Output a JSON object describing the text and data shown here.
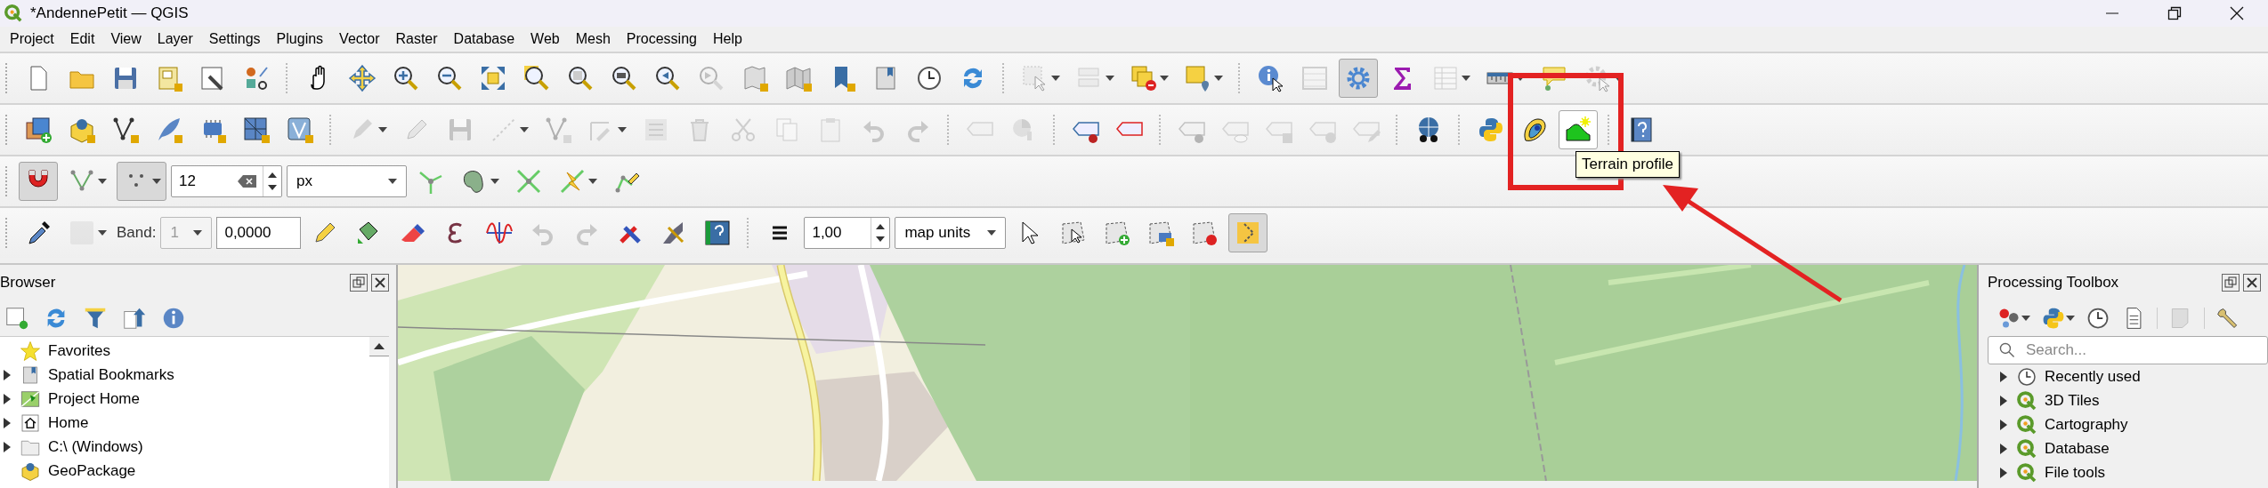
{
  "window": {
    "title": "*AndennePetit — QGIS"
  },
  "menu_bar": [
    "Project",
    "Edit",
    "View",
    "Layer",
    "Settings",
    "Plugins",
    "Vector",
    "Raster",
    "Database",
    "Web",
    "Mesh",
    "Processing",
    "Help"
  ],
  "toolbars": [
    {
      "items": [
        {
          "kind": "button",
          "disabled": false,
          "checked": false,
          "hovered": false,
          "dropdown": false
        },
        {
          "kind": "button",
          "disabled": false,
          "checked": false,
          "hovered": false,
          "dropdown": false
        },
        {
          "kind": "button",
          "disabled": false,
          "checked": false,
          "hovered": false,
          "dropdown": false
        },
        {
          "kind": "button",
          "disabled": false,
          "checked": false,
          "hovered": false,
          "dropdown": false
        },
        {
          "kind": "button",
          "disabled": false,
          "checked": false,
          "hovered": false,
          "dropdown": false
        },
        {
          "kind": "button",
          "disabled": false,
          "checked": false,
          "hovered": false,
          "dropdown": false
        },
        {
          "kind": "separator"
        },
        {
          "kind": "button",
          "disabled": false,
          "checked": false,
          "hovered": false,
          "dropdown": false
        },
        {
          "kind": "button",
          "disabled": false,
          "checked": false,
          "hovered": false,
          "dropdown": false
        },
        {
          "kind": "button",
          "disabled": false,
          "checked": false,
          "hovered": false,
          "dropdown": false
        },
        {
          "kind": "button",
          "disabled": false,
          "checked": false,
          "hovered": false,
          "dropdown": false
        },
        {
          "kind": "button",
          "disabled": false,
          "checked": false,
          "hovered": false,
          "dropdown": false
        },
        {
          "kind": "button",
          "disabled": false,
          "checked": false,
          "hovered": false,
          "dropdown": false
        },
        {
          "kind": "button",
          "disabled": false,
          "checked": false,
          "hovered": false,
          "dropdown": false
        },
        {
          "kind": "button",
          "disabled": false,
          "checked": false,
          "hovered": false,
          "dropdown": false
        },
        {
          "kind": "button",
          "disabled": false,
          "checked": false,
          "hovered": false,
          "dropdown": false
        },
        {
          "kind": "button",
          "disabled": true,
          "checked": false,
          "hovered": false,
          "dropdown": false
        },
        {
          "kind": "button",
          "disabled": false,
          "checked": false,
          "hovered": false,
          "dropdown": false
        },
        {
          "kind": "button",
          "disabled": false,
          "checked": false,
          "hovered": false,
          "dropdown": false
        },
        {
          "kind": "button",
          "disabled": false,
          "checked": false,
          "hovered": false,
          "dropdown": false
        },
        {
          "kind": "button",
          "disabled": false,
          "checked": false,
          "hovered": false,
          "dropdown": false
        },
        {
          "kind": "button",
          "disabled": false,
          "checked": false,
          "hovered": false,
          "dropdown": false
        },
        {
          "kind": "button",
          "disabled": false,
          "checked": false,
          "hovered": false,
          "dropdown": false
        },
        {
          "kind": "separator"
        },
        {
          "kind": "button",
          "disabled": true,
          "checked": false,
          "hovered": false,
          "dropdown": true
        },
        {
          "kind": "button",
          "disabled": true,
          "checked": false,
          "hovered": false,
          "dropdown": true
        },
        {
          "kind": "button",
          "disabled": false,
          "checked": false,
          "hovered": false,
          "dropdown": true
        },
        {
          "kind": "button",
          "disabled": false,
          "checked": false,
          "hovered": false,
          "dropdown": true
        },
        {
          "kind": "separator"
        },
        {
          "kind": "button",
          "disabled": false,
          "checked": false,
          "hovered": false,
          "dropdown": false
        },
        {
          "kind": "button",
          "disabled": true,
          "checked": false,
          "hovered": false,
          "dropdown": false
        },
        {
          "kind": "button",
          "disabled": false,
          "checked": true,
          "hovered": false,
          "dropdown": false
        },
        {
          "kind": "button",
          "disabled": false,
          "checked": false,
          "hovered": false,
          "dropdown": false
        },
        {
          "kind": "button",
          "disabled": true,
          "checked": false,
          "hovered": false,
          "dropdown": true
        },
        {
          "kind": "button",
          "disabled": false,
          "checked": false,
          "hovered": false,
          "dropdown": true
        },
        {
          "kind": "button",
          "disabled": false,
          "checked": false,
          "hovered": false,
          "dropdown": false
        },
        {
          "kind": "button",
          "disabled": true,
          "checked": false,
          "hovered": false,
          "dropdown": true
        }
      ]
    },
    {
      "items": [
        {
          "kind": "button",
          "disabled": false,
          "checked": false,
          "hovered": false,
          "dropdown": false
        },
        {
          "kind": "button",
          "disabled": false,
          "checked": false,
          "hovered": false,
          "dropdown": false
        },
        {
          "kind": "button",
          "disabled": false,
          "checked": false,
          "hovered": false,
          "dropdown": false
        },
        {
          "kind": "button",
          "disabled": false,
          "checked": false,
          "hovered": false,
          "dropdown": false
        },
        {
          "kind": "button",
          "disabled": false,
          "checked": false,
          "hovered": false,
          "dropdown": false
        },
        {
          "kind": "button",
          "disabled": false,
          "checked": false,
          "hovered": false,
          "dropdown": false
        },
        {
          "kind": "button",
          "disabled": false,
          "checked": false,
          "hovered": false,
          "dropdown": false
        },
        {
          "kind": "separator"
        },
        {
          "kind": "button",
          "disabled": true,
          "checked": false,
          "hovered": false,
          "dropdown": true
        },
        {
          "kind": "button",
          "disabled": true,
          "checked": false,
          "hovered": false,
          "dropdown": false
        },
        {
          "kind": "button",
          "disabled": true,
          "checked": false,
          "hovered": false,
          "dropdown": false
        },
        {
          "kind": "button",
          "disabled": true,
          "checked": false,
          "hovered": false,
          "dropdown": true
        },
        {
          "kind": "button",
          "disabled": true,
          "checked": false,
          "hovered": false,
          "dropdown": false
        },
        {
          "kind": "button",
          "disabled": true,
          "checked": false,
          "hovered": false,
          "dropdown": true
        },
        {
          "kind": "button",
          "disabled": true,
          "checked": false,
          "hovered": false,
          "dropdown": false
        },
        {
          "kind": "button",
          "disabled": true,
          "checked": false,
          "hovered": false,
          "dropdown": false
        },
        {
          "kind": "button",
          "disabled": true,
          "checked": false,
          "hovered": false,
          "dropdown": false
        },
        {
          "kind": "button",
          "disabled": true,
          "checked": false,
          "hovered": false,
          "dropdown": false
        },
        {
          "kind": "button",
          "disabled": true,
          "checked": false,
          "hovered": false,
          "dropdown": false
        },
        {
          "kind": "button",
          "disabled": true,
          "checked": false,
          "hovered": false,
          "dropdown": false
        },
        {
          "kind": "button",
          "disabled": true,
          "checked": false,
          "hovered": false,
          "dropdown": false
        },
        {
          "kind": "separator"
        },
        {
          "kind": "button",
          "disabled": true,
          "checked": false,
          "hovered": false,
          "dropdown": false
        },
        {
          "kind": "button",
          "disabled": true,
          "checked": false,
          "hovered": false,
          "dropdown": false
        },
        {
          "kind": "separator"
        },
        {
          "kind": "button",
          "disabled": false,
          "checked": false,
          "hovered": false,
          "dropdown": false
        },
        {
          "kind": "button",
          "disabled": false,
          "checked": false,
          "hovered": false,
          "dropdown": false
        },
        {
          "kind": "separator"
        },
        {
          "kind": "button",
          "disabled": true,
          "checked": false,
          "hovered": false,
          "dropdown": false
        },
        {
          "kind": "button",
          "disabled": true,
          "checked": false,
          "hovered": false,
          "dropdown": false
        },
        {
          "kind": "button",
          "disabled": true,
          "checked": false,
          "hovered": false,
          "dropdown": false
        },
        {
          "kind": "button",
          "disabled": true,
          "checked": false,
          "hovered": false,
          "dropdown": false
        },
        {
          "kind": "button",
          "disabled": true,
          "checked": false,
          "hovered": false,
          "dropdown": false
        },
        {
          "kind": "separator"
        },
        {
          "kind": "button",
          "disabled": false,
          "checked": false,
          "hovered": false,
          "dropdown": false
        },
        {
          "kind": "separator"
        },
        {
          "kind": "button",
          "disabled": false,
          "checked": false,
          "hovered": false,
          "dropdown": false
        },
        {
          "kind": "button",
          "disabled": false,
          "checked": false,
          "hovered": false,
          "dropdown": false
        },
        {
          "kind": "button",
          "disabled": false,
          "checked": false,
          "hovered": true,
          "dropdown": false
        },
        {
          "kind": "separator"
        },
        {
          "kind": "button",
          "disabled": false,
          "checked": false,
          "hovered": false,
          "dropdown": false
        }
      ]
    },
    {
      "items": [
        {
          "kind": "button",
          "disabled": false,
          "checked": true,
          "hovered": false,
          "dropdown": false
        },
        {
          "kind": "button",
          "disabled": false,
          "checked": false,
          "hovered": false,
          "dropdown": true
        },
        {
          "kind": "button",
          "disabled": false,
          "checked": true,
          "hovered": false,
          "dropdown": true
        },
        {
          "kind": "spinbox",
          "value": "12",
          "clearable": true
        },
        {
          "kind": "combo",
          "value": "px",
          "disabled": false
        },
        {
          "kind": "button",
          "disabled": false,
          "checked": false,
          "hovered": false,
          "dropdown": false
        },
        {
          "kind": "button",
          "disabled": false,
          "checked": false,
          "hovered": false,
          "dropdown": true
        },
        {
          "kind": "button",
          "disabled": false,
          "checked": false,
          "hovered": false,
          "dropdown": false
        },
        {
          "kind": "button",
          "disabled": false,
          "checked": false,
          "hovered": false,
          "dropdown": true
        },
        {
          "kind": "button",
          "disabled": false,
          "checked": false,
          "hovered": false,
          "dropdown": false
        }
      ]
    },
    {
      "items": [
        {
          "kind": "button",
          "disabled": false,
          "checked": false,
          "hovered": false,
          "dropdown": false
        },
        {
          "kind": "button",
          "disabled": true,
          "checked": false,
          "hovered": false,
          "dropdown": true
        },
        {
          "kind": "label",
          "text": "Band:"
        },
        {
          "kind": "combo",
          "value": "1",
          "disabled": true
        },
        {
          "kind": "field",
          "value": "0,0000"
        },
        {
          "kind": "button",
          "disabled": false,
          "checked": false,
          "hovered": false,
          "dropdown": false
        },
        {
          "kind": "button",
          "disabled": false,
          "checked": false,
          "hovered": false,
          "dropdown": false
        },
        {
          "kind": "button",
          "disabled": false,
          "checked": false,
          "hovered": false,
          "dropdown": false
        },
        {
          "kind": "button",
          "disabled": false,
          "checked": false,
          "hovered": false,
          "dropdown": false
        },
        {
          "kind": "button",
          "disabled": false,
          "checked": false,
          "hovered": false,
          "dropdown": false
        },
        {
          "kind": "button",
          "disabled": true,
          "checked": false,
          "hovered": false,
          "dropdown": false
        },
        {
          "kind": "button",
          "disabled": true,
          "checked": false,
          "hovered": false,
          "dropdown": false
        },
        {
          "kind": "button",
          "disabled": false,
          "checked": false,
          "hovered": false,
          "dropdown": false
        },
        {
          "kind": "button",
          "disabled": false,
          "checked": false,
          "hovered": false,
          "dropdown": false
        },
        {
          "kind": "button",
          "disabled": false,
          "checked": false,
          "hovered": false,
          "dropdown": false
        },
        {
          "kind": "separator"
        },
        {
          "kind": "button",
          "disabled": false,
          "checked": false,
          "hovered": false,
          "dropdown": false
        },
        {
          "kind": "spinbox",
          "value": "1,00",
          "clearable": false
        },
        {
          "kind": "combo",
          "value": "map units",
          "disabled": false
        },
        {
          "kind": "button",
          "disabled": false,
          "checked": false,
          "hovered": false,
          "dropdown": false
        },
        {
          "kind": "button",
          "disabled": false,
          "checked": false,
          "hovered": false,
          "dropdown": false
        },
        {
          "kind": "button",
          "disabled": false,
          "checked": false,
          "hovered": false,
          "dropdown": false
        },
        {
          "kind": "button",
          "disabled": false,
          "checked": false,
          "hovered": false,
          "dropdown": false
        },
        {
          "kind": "button",
          "disabled": false,
          "checked": false,
          "hovered": false,
          "dropdown": false
        },
        {
          "kind": "button",
          "disabled": false,
          "checked": true,
          "hovered": false,
          "dropdown": false
        }
      ]
    }
  ],
  "tooltip": {
    "text": "Terrain profile"
  },
  "browser": {
    "title": "Browser",
    "items": [
      {
        "label": "Favorites",
        "expandable": false
      },
      {
        "label": "Spatial Bookmarks",
        "expandable": true
      },
      {
        "label": "Project Home",
        "expandable": true
      },
      {
        "label": "Home",
        "expandable": true
      },
      {
        "label": "C:\\ (Windows)",
        "expandable": true
      },
      {
        "label": "GeoPackage",
        "expandable": false
      }
    ]
  },
  "processing": {
    "title": "Processing Toolbox",
    "search": {
      "placeholder": "Search..."
    },
    "items": [
      {
        "label": "Recently used",
        "expandable": true
      },
      {
        "label": "3D Tiles",
        "expandable": true
      },
      {
        "label": "Cartography",
        "expandable": true
      },
      {
        "label": "Database",
        "expandable": true
      },
      {
        "label": "File tools",
        "expandable": true
      }
    ]
  }
}
